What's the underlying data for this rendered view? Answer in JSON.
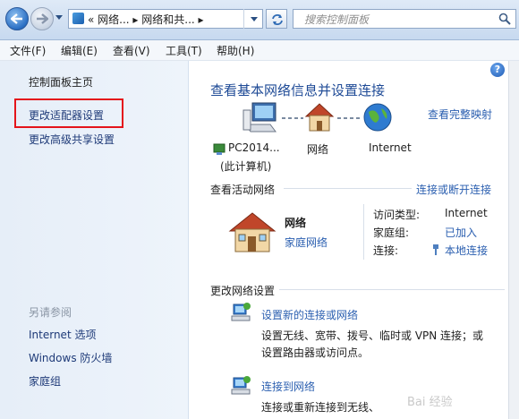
{
  "address_bar": {
    "breadcrumb": "« 网络... ▸ 网络和共... ▸",
    "search_placeholder": "搜索控制面板"
  },
  "menu": [
    "文件(F)",
    "编辑(E)",
    "查看(V)",
    "工具(T)",
    "帮助(H)"
  ],
  "sidebar": {
    "home": "控制面板主页",
    "items": [
      "更改适配器设置",
      "更改高级共享设置"
    ],
    "see_also_title": "另请参阅",
    "see_also": [
      "Internet 选项",
      "Windows 防火墙",
      "家庭组"
    ]
  },
  "main": {
    "title": "查看基本网络信息并设置连接",
    "full_map_link": "查看完整映射",
    "map": {
      "computer_name": "PC2014...",
      "computer_sub": "(此计算机)",
      "network": "网络",
      "internet": "Internet"
    },
    "active_title": "查看活动网络",
    "connect_link": "连接或断开连接",
    "active": {
      "name": "网络",
      "type_link": "家庭网络",
      "access_label": "访问类型:",
      "access_value": "Internet",
      "homegroup_label": "家庭组:",
      "homegroup_value": "已加入",
      "connection_label": "连接:",
      "connection_value": "本地连接"
    },
    "change_title": "更改网络设置",
    "tasks": [
      {
        "link": "设置新的连接或网络",
        "desc1": "设置无线、宽带、拨号、临时或 VPN 连接；或",
        "desc2": "设置路由器或访问点。"
      },
      {
        "link": "连接到网络",
        "desc1": "连接或重新连接到无线、"
      }
    ]
  },
  "watermark": "Bai 经验",
  "colors": {
    "highlight_box": "#e4141b",
    "link": "#2b5fb0",
    "title": "#1e4a96"
  }
}
